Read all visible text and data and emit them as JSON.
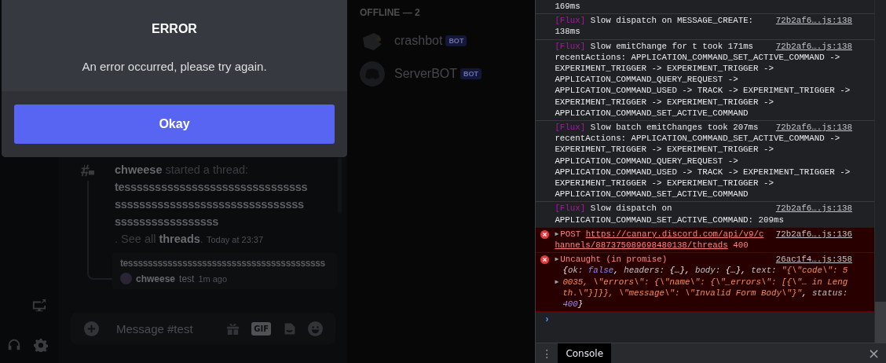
{
  "dialog": {
    "title": "ERROR",
    "message": "An error occurred, please try again.",
    "button": "Okay"
  },
  "chat": {
    "thread_starter": {
      "author": "chweese",
      "action": "started a thread:",
      "lines": [
        "tessssssssssssssssssssssssssssss",
        "sssssssssssssssssssssssssssssss",
        "sssssssssssssssss"
      ],
      "prefix": ". See all",
      "link": "threads",
      "suffix": ".",
      "time": "Today at 23:37"
    },
    "thread_card": {
      "title": "tessssssssssssssssssssssssssssssssssssssss",
      "author": "chweese",
      "last_message": "test",
      "age": "1m ago"
    },
    "composer": {
      "placeholder": "Message #test",
      "gif": "GIF"
    }
  },
  "members": {
    "heading": "OFFLINE — 2",
    "items": [
      {
        "name": "crashbot",
        "badge": "BOT",
        "kind": "mascot"
      },
      {
        "name": "ServerBOT",
        "badge": "BOT",
        "kind": "logo"
      }
    ]
  },
  "console": {
    "messages": [
      {
        "kind": "log",
        "lines": [
          "169ms"
        ]
      },
      {
        "kind": "log",
        "tag": "[Flux]",
        "lines": [
          "Slow dispatch on MESSAGE_CREATE:",
          "138ms"
        ],
        "source": "72b2af6….js:138"
      },
      {
        "kind": "log",
        "tag": "[Flux]",
        "lines": [
          "Slow emitChange for t took 171ms",
          "recentActions: APPLICATION_COMMAND_SET_ACTIVE_COMMAND ->",
          "EXPERIMENT_TRIGGER -> EXPERIMENT_TRIGGER ->",
          "APPLICATION_COMMAND_QUERY_REQUEST ->",
          "APPLICATION_COMMAND_USED -> TRACK -> EXPERIMENT_TRIGGER ->",
          "EXPERIMENT_TRIGGER -> EXPERIMENT_TRIGGER ->",
          "APPLICATION_COMMAND_SET_ACTIVE_COMMAND"
        ],
        "source": "72b2af6….js:138"
      },
      {
        "kind": "log",
        "tag": "[Flux]",
        "lines": [
          "Slow batch emitChanges took 207ms",
          "recentActions: APPLICATION_COMMAND_SET_ACTIVE_COMMAND ->",
          "EXPERIMENT_TRIGGER -> EXPERIMENT_TRIGGER ->",
          "APPLICATION_COMMAND_QUERY_REQUEST ->",
          "APPLICATION_COMMAND_USED -> TRACK -> EXPERIMENT_TRIGGER ->",
          "EXPERIMENT_TRIGGER -> EXPERIMENT_TRIGGER ->",
          "APPLICATION_COMMAND_SET_ACTIVE_COMMAND"
        ],
        "source": "72b2af6….js:138"
      },
      {
        "kind": "log",
        "tag": "[Flux]",
        "lines": [
          "Slow dispatch on",
          "APPLICATION_COMMAND_SET_ACTIVE_COMMAND: 209ms"
        ],
        "source": "72b2af6….js:138"
      },
      {
        "kind": "network_error",
        "expander": "▶",
        "method": "POST",
        "url_lines": [
          "https://canary.discord.com/api/v9/c",
          "hannels/887375089698480138/threads"
        ],
        "status": "400",
        "source": "72b2af6….js:136"
      },
      {
        "kind": "exception",
        "expander": "▶",
        "title": "Uncaught (in promise)",
        "source": "26ac1f4….js:358",
        "object_lines": [
          {
            "segments": [
              {
                "kind": "punct",
                "text": "{"
              },
              {
                "kind": "key",
                "text": "ok: "
              },
              {
                "kind": "keyword",
                "text": "false"
              },
              {
                "kind": "punct",
                "text": ", "
              },
              {
                "kind": "key",
                "text": "headers: "
              },
              {
                "kind": "punct",
                "text": "{…}, "
              },
              {
                "kind": "key",
                "text": "body: "
              },
              {
                "kind": "punct",
                "text": "{…}, "
              },
              {
                "kind": "key",
                "text": "text: "
              },
              {
                "kind": "string",
                "text": "\"{\\\"code\\\": 5"
              }
            ]
          },
          {
            "segments": [
              {
                "kind": "string",
                "text": "0035, \\\"errors\\\": {\\\"name\\\": {\\\"_errors\\\": [{\\\"… in Leng"
              }
            ],
            "expander": "▶"
          },
          {
            "segments": [
              {
                "kind": "string",
                "text": "th.\\\"}]}}, \\\"message\\\": \\\"Invalid Form Body\\\"}\""
              },
              {
                "kind": "punct",
                "text": ", "
              },
              {
                "kind": "key",
                "text": "status:"
              }
            ]
          },
          {
            "segments": [
              {
                "kind": "number",
                "text": "400"
              },
              {
                "kind": "punct",
                "text": "}"
              }
            ]
          }
        ]
      }
    ],
    "prompt": "›",
    "drawer": {
      "menu": "⋮",
      "tab": "Console",
      "close": "×"
    }
  }
}
